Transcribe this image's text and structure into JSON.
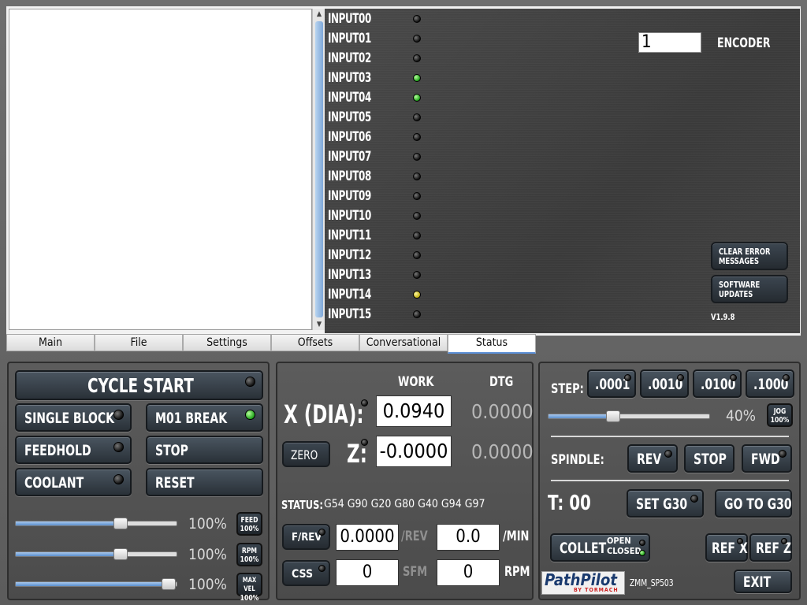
{
  "inputs": [
    {
      "label": "INPUT00",
      "state": "off"
    },
    {
      "label": "INPUT01",
      "state": "off"
    },
    {
      "label": "INPUT02",
      "state": "off"
    },
    {
      "label": "INPUT03",
      "state": "green"
    },
    {
      "label": "INPUT04",
      "state": "green"
    },
    {
      "label": "INPUT05",
      "state": "off"
    },
    {
      "label": "INPUT06",
      "state": "off"
    },
    {
      "label": "INPUT07",
      "state": "off"
    },
    {
      "label": "INPUT08",
      "state": "off"
    },
    {
      "label": "INPUT09",
      "state": "off"
    },
    {
      "label": "INPUT10",
      "state": "off"
    },
    {
      "label": "INPUT11",
      "state": "off"
    },
    {
      "label": "INPUT12",
      "state": "off"
    },
    {
      "label": "INPUT13",
      "state": "off"
    },
    {
      "label": "INPUT14",
      "state": "yellow"
    },
    {
      "label": "INPUT15",
      "state": "off"
    }
  ],
  "encoder": {
    "value": "1",
    "label": "ENCODER"
  },
  "status_panel": {
    "clear_errors": [
      "CLEAR ERROR",
      "MESSAGES"
    ],
    "software_updates": [
      "SOFTWARE",
      "UPDATES"
    ],
    "version": "V1.9.8"
  },
  "tabs": [
    {
      "label": "Main",
      "active": false
    },
    {
      "label": "File",
      "active": false
    },
    {
      "label": "Settings",
      "active": false
    },
    {
      "label": "Offsets",
      "active": false
    },
    {
      "label": "Conversational",
      "active": false
    },
    {
      "label": "Status",
      "active": true
    }
  ],
  "controls": {
    "cycle_start": "CYCLE START",
    "single_block": "SINGLE BLOCK",
    "m01_break": "M01 BREAK",
    "feedhold": "FEEDHOLD",
    "stop": "STOP",
    "coolant": "COOLANT",
    "reset": "RESET",
    "feed": {
      "pct": "100%",
      "badge": [
        "FEED",
        "100%"
      ],
      "level": 0.65
    },
    "rpm": {
      "pct": "100%",
      "badge": [
        "RPM",
        "100%"
      ],
      "level": 0.65
    },
    "maxvel": {
      "pct": "100%",
      "badge": [
        "MAX VEL",
        "100%"
      ],
      "level": 0.95
    }
  },
  "dro": {
    "work_header": "WORK",
    "dtg_header": "DTG",
    "x_label": "X (DIA):",
    "x_work": "0.0940",
    "x_dtg": "0.0000",
    "z_label": "Z:",
    "z_work": "-0.0000",
    "z_dtg": "0.0000",
    "zero_button": "ZERO",
    "status_label": "STATUS:",
    "status_codes": "G54 G90 G20 G80 G40 G94 G97",
    "frev_button": "F/REV",
    "frev_value": "0.0000",
    "frev_unit": "/REV",
    "min_value": "0.0",
    "min_unit": "/MIN",
    "css_button": "CSS",
    "sfm_value": "0",
    "sfm_unit": "SFM",
    "rpm_value": "0",
    "rpm_unit": "RPM"
  },
  "jog": {
    "step_label": "STEP:",
    "steps": [
      ".0001",
      ".0010",
      ".0100",
      ".1000"
    ],
    "jog_pct": "40%",
    "jog_level": 0.4,
    "jog_badge": [
      "JOG",
      "100%"
    ],
    "spindle_label": "SPINDLE:",
    "rev": "REV",
    "stop": "STOP",
    "fwd": "FWD",
    "tool_label": "T: 00",
    "set_g30": "SET G30",
    "go_to_g30": "GO TO G30",
    "collet": "COLLET",
    "collet_open": "OPEN",
    "collet_closed": "CLOSED",
    "ref_x": "REF X",
    "ref_z": "REF Z",
    "logo": "PathPilot",
    "logo_sub": "BY TORMACH",
    "machine": "ZMM_SP503",
    "exit": "EXIT"
  }
}
